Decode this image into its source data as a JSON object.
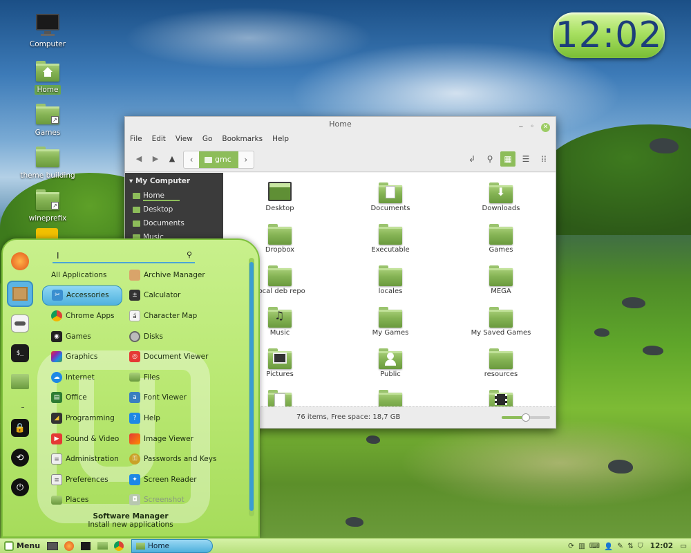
{
  "desktop": {
    "icons": [
      {
        "label": "Computer"
      },
      {
        "label": "Home"
      },
      {
        "label": "Games"
      },
      {
        "label": "theme building"
      },
      {
        "label": "wineprefix"
      }
    ]
  },
  "clock": {
    "time": "12:02"
  },
  "file_manager": {
    "title": "Home",
    "menu": [
      "File",
      "Edit",
      "View",
      "Go",
      "Bookmarks",
      "Help"
    ],
    "breadcrumb": {
      "current": "gmc"
    },
    "sidebar": {
      "header": "My Computer",
      "items": [
        "Home",
        "Desktop",
        "Documents",
        "Music"
      ]
    },
    "items": [
      "Desktop",
      "Documents",
      "Downloads",
      "Dropbox",
      "Executable",
      "Games",
      "Local deb repo",
      "locales",
      "MEGA",
      "Music",
      "My Games",
      "My Saved Games",
      "Pictures",
      "Public",
      "resources"
    ],
    "status": "76 items, Free space: 18,7 GB",
    "zoom_fraction": 0.5
  },
  "start_menu": {
    "search_placeholder": "I",
    "categories": [
      "All Applications",
      "Accessories",
      "Chrome Apps",
      "Games",
      "Graphics",
      "Internet",
      "Office",
      "Programming",
      "Sound & Video",
      "Administration",
      "Preferences",
      "Places"
    ],
    "apps": [
      "Archive Manager",
      "Calculator",
      "Character Map",
      "Disks",
      "Document Viewer",
      "Files",
      "Font Viewer",
      "Help",
      "Image Viewer",
      "Passwords and Keys",
      "Screen Reader",
      "Screenshot"
    ],
    "software_manager": {
      "title": "Software Manager",
      "subtitle": "Install new applications"
    }
  },
  "taskbar": {
    "menu_label": "Menu",
    "task_label": "Home",
    "time": "12:02"
  },
  "colors": {
    "accent": "#8dbd5a",
    "selection": "#4fb1de",
    "sidebar_bg": "#3b3b3b"
  }
}
